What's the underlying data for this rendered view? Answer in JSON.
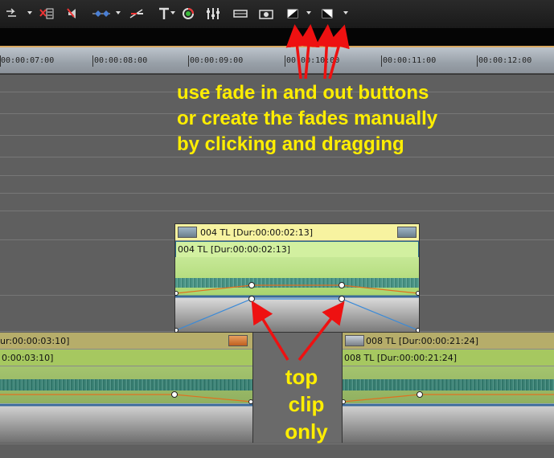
{
  "toolbar": {
    "icons": [
      "snap-icon",
      "cut-icon",
      "mute-icon",
      "keyframe-icon",
      "render-icon",
      "text-icon",
      "color-icon",
      "mixer-icon",
      "timeline-icon",
      "snapshot-icon",
      "fade-in-icon",
      "fade-out-icon"
    ]
  },
  "ruler": {
    "ticks": [
      "00:00:07:00",
      "00:00:08:00",
      "00:00:09:00",
      "00:00:10:00",
      "00:00:11:00",
      "00:00:12:00"
    ]
  },
  "clips": {
    "top": {
      "header": "004  TL [Dur:00:00:02:13]",
      "sub": "004  TL [Dur:00:00:02:13]"
    },
    "left": {
      "header": "ur:00:00:03:10]",
      "sub": "0:00:03:10]"
    },
    "right": {
      "header": "008  TL [Dur:00:00:21:24]",
      "sub": "008  TL [Dur:00:00:21:24]"
    }
  },
  "annotations": {
    "main_line1": "use fade in and out buttons",
    "main_line2": "or create the fades manually",
    "main_line3": "by clicking and dragging",
    "side_line1": "top",
    "side_line2": "clip",
    "side_line3": "only"
  },
  "colors": {
    "annotation": "#ffee00",
    "arrow": "#ee1111",
    "clip_header_yellow": "#f7f3a0",
    "clip_green": "#b7e07a",
    "audio_wave": "#3a8a8a"
  }
}
